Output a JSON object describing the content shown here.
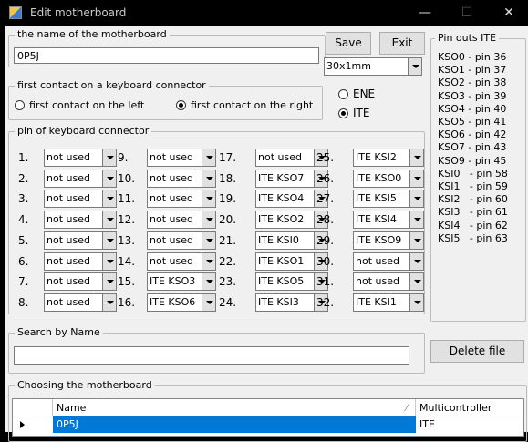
{
  "window": {
    "title": "Edit motherboard",
    "minimize": "—",
    "maximize": "☐",
    "close": "✕"
  },
  "name_group": {
    "legend": "the name of the motherboard",
    "value": "0P5J"
  },
  "buttons": {
    "save": "Save",
    "exit": "Exit",
    "delete": "Delete file"
  },
  "size_select": {
    "value": "30x1mm"
  },
  "first_contact": {
    "legend": "first contact on a keyboard connector",
    "left_label": "first contact on the left",
    "right_label": "first contact on the right",
    "selected": "right"
  },
  "controller": {
    "options": [
      "ENE",
      "ITE"
    ],
    "selected": "ITE"
  },
  "pins_group": {
    "legend": "pin of keyboard connector",
    "pins": [
      {
        "num": "1.",
        "value": "not used"
      },
      {
        "num": "2.",
        "value": "not used"
      },
      {
        "num": "3.",
        "value": "not used"
      },
      {
        "num": "4.",
        "value": "not used"
      },
      {
        "num": "5.",
        "value": "not used"
      },
      {
        "num": "6.",
        "value": "not used"
      },
      {
        "num": "7.",
        "value": "not used"
      },
      {
        "num": "8.",
        "value": "not used"
      },
      {
        "num": "9.",
        "value": "not used"
      },
      {
        "num": "10.",
        "value": "not used"
      },
      {
        "num": "11.",
        "value": "not used"
      },
      {
        "num": "12.",
        "value": "not used"
      },
      {
        "num": "13.",
        "value": "not used"
      },
      {
        "num": "14.",
        "value": "not used"
      },
      {
        "num": "15.",
        "value": "ITE KSO3"
      },
      {
        "num": "16.",
        "value": "ITE KSO6"
      },
      {
        "num": "17.",
        "value": "not used"
      },
      {
        "num": "18.",
        "value": "ITE KSO7"
      },
      {
        "num": "19.",
        "value": "ITE KSO4"
      },
      {
        "num": "20.",
        "value": "ITE KSO2"
      },
      {
        "num": "21.",
        "value": "ITE KSI0"
      },
      {
        "num": "22.",
        "value": "ITE KSO1"
      },
      {
        "num": "23.",
        "value": "ITE KSO5"
      },
      {
        "num": "24.",
        "value": "ITE KSI3"
      },
      {
        "num": "25.",
        "value": "ITE KSI2"
      },
      {
        "num": "26.",
        "value": "ITE KSO0"
      },
      {
        "num": "27.",
        "value": "ITE KSI5"
      },
      {
        "num": "28.",
        "value": "ITE KSI4"
      },
      {
        "num": "29.",
        "value": "ITE KSO9"
      },
      {
        "num": "30.",
        "value": "not used"
      },
      {
        "num": "31.",
        "value": "not used"
      },
      {
        "num": "32.",
        "value": "ITE KSI1"
      }
    ]
  },
  "pinouts": {
    "legend": "Pin outs ITE",
    "items": [
      "KSO0 - pin 36",
      "KSO1 - pin 37",
      "KSO2 - pin 38",
      "KSO3 - pin 39",
      "KSO4 - pin 40",
      "KSO5 - pin 41",
      "KSO6 - pin 42",
      "KSO7 - pin 43",
      "KSO9 - pin 45",
      "KSI0   - pin 58",
      "KSI1   - pin 59",
      "KSI2   - pin 60",
      "KSI3   - pin 61",
      "KSI4   - pin 62",
      "KSI5   - pin 63"
    ]
  },
  "search": {
    "legend": "Search by Name",
    "value": ""
  },
  "choosing": {
    "legend": "Choosing the motherboard",
    "columns": [
      "Name",
      "Multicontroller"
    ],
    "rows": [
      {
        "name": "0P5J",
        "controller": "ITE"
      }
    ]
  },
  "colors": {
    "selection": "#0078d7",
    "titlebar": "#000000"
  }
}
